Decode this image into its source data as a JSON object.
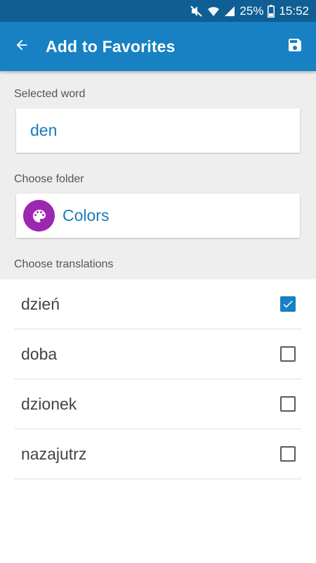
{
  "status_bar": {
    "battery": "25%",
    "time": "15:52",
    "icons": [
      "mute-icon",
      "wifi-icon",
      "signal-icon",
      "battery-icon"
    ]
  },
  "app_bar": {
    "title": "Add to Favorites",
    "back_icon": "arrow-back-icon",
    "save_icon": "save-icon"
  },
  "form": {
    "selected_word_label": "Selected word",
    "selected_word": "den",
    "choose_folder_label": "Choose folder",
    "folder_name": "Colors",
    "folder_icon": "palette-icon",
    "folder_icon_color": "#9c27b0",
    "choose_translations_label": "Choose translations"
  },
  "translations": [
    {
      "text": "dzień",
      "checked": true
    },
    {
      "text": "doba",
      "checked": false
    },
    {
      "text": "dzionek",
      "checked": false
    },
    {
      "text": "nazajutrz",
      "checked": false
    }
  ],
  "colors": {
    "status_bar": "#0f5f95",
    "app_bar": "#1781c4",
    "accent_text": "#1a7bbd",
    "background_gray": "#eeeeee"
  }
}
